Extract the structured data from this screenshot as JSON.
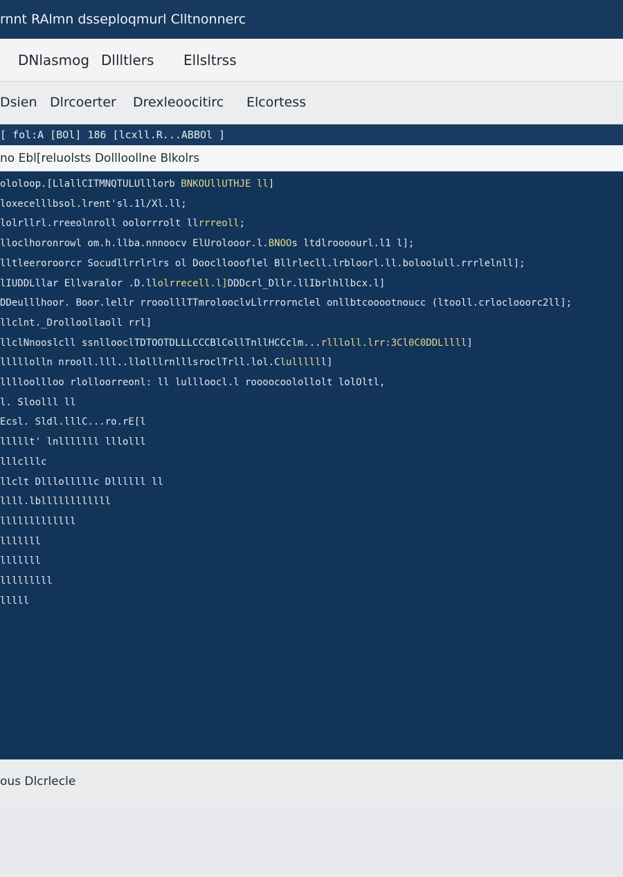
{
  "window": {
    "title": "rnnt RAlmn dsseploqmurl Clltnonnerc"
  },
  "menu": {
    "items": [
      "DNlasmog",
      "Dllltlers",
      "Ellsltrss"
    ]
  },
  "toolbar": {
    "items": [
      "Dsien",
      "Dlrcoerter",
      "Drexleoocitirc",
      "Elcortess"
    ]
  },
  "path_bar": {
    "text": "[ fol:A [BOl] 186 [lcxll.R...ABBOl ]"
  },
  "columns_header": {
    "text": "no Ebl[reluolsts Dollloollne Blkolrs"
  },
  "terminal": {
    "lines": [
      {
        "pre": "ololoop.[LlallCITMNQTULUlllorb",
        "hl": " BNKOUllUTHJE ll",
        "post": "]"
      },
      {
        "pre": "loxecelllbsol.lrent'sl.1l/Xl.ll;",
        "hl": "",
        "post": ""
      },
      {
        "pre": "lolrllrl.rreeolnroll oolorrrolt ll",
        "hl": "rrreoll",
        "post": ";"
      },
      {
        "pre": "lloclhoronrowl om.h.llba.nnnoocv ElUrolooor.l.",
        "hl": "BNOO",
        "post": "s ltdlroooourl.l1 l];"
      },
      {
        "pre": "lltleeroroorcr Socudllrrlrlrs ol Dooclloooflel Bllrlecll.lrbloorl.ll.boloolull.rrrlelnll",
        "hl": "",
        "post": "];"
      },
      {
        "pre": "lIUDDLllar Ellvaralor .D.ll",
        "hl": "olrrecell.l]",
        "post": "DDDcrl_Dllr.llIbrlhllbcx.l]"
      },
      {
        "pre": "DDeulllhoor. Boor.lellr rrooolllTTmrolooclvLlrrrornclel onllbtcooootnoucc (ltooll.crloclooorc2ll",
        "hl": "",
        "post": "];"
      },
      {
        "pre": "llclnt._Drolloollaoll rrl",
        "hl": "",
        "post": "]"
      },
      {
        "pre": "llclNnooslcll ssnllooclTDTOOTDLLLCCCBlCollTnllHCCclm...",
        "hl": "rllloll.lrr:3Cl0C0DDLllll",
        "post": "]"
      },
      {
        "pre": "lllllolln nrooll.lll..llolllrnlllsroclTrll.lol.C",
        "hl": "lulllll",
        "post": "l]"
      },
      {
        "pre": "lllloollloo rlolloorreonl: ll lullloocl.l roooocoolollolt lolOltl",
        "hl": "",
        "post": ","
      },
      {
        "pre": "l. Sloolll ll",
        "hl": "",
        "post": ""
      },
      {
        "pre": "Ecsl. Sldl.lllC...ro.rE[l",
        "hl": "",
        "post": ""
      },
      {
        "pre": "lllllt' lnlllllll lllolll",
        "hl": "",
        "post": ""
      },
      {
        "pre": "lllclllc",
        "hl": "",
        "post": ""
      },
      {
        "pre": "llclt Dlllolllllc Dllllll ll",
        "hl": "",
        "post": ""
      },
      {
        "pre": "llll.lbllllllllllll",
        "hl": "",
        "post": ""
      },
      {
        "pre": "lllllllllllll",
        "hl": "",
        "post": ""
      },
      {
        "pre": "lllllll",
        "hl": "",
        "post": ""
      },
      {
        "pre": "lllllll",
        "hl": "",
        "post": ""
      },
      {
        "pre": "lllllllll",
        "hl": "",
        "post": ""
      },
      {
        "pre": "lllll",
        "hl": "",
        "post": ""
      },
      {
        "pre": "",
        "hl": "",
        "post": ""
      },
      {
        "pre": "",
        "hl": "",
        "post": ""
      },
      {
        "pre": "",
        "hl": "",
        "post": ""
      },
      {
        "pre": "",
        "hl": "",
        "post": ""
      },
      {
        "pre": "",
        "hl": "",
        "post": ""
      },
      {
        "pre": "",
        "hl": "",
        "post": ""
      }
    ]
  },
  "status": {
    "text": "ous Dlcrlecle"
  }
}
